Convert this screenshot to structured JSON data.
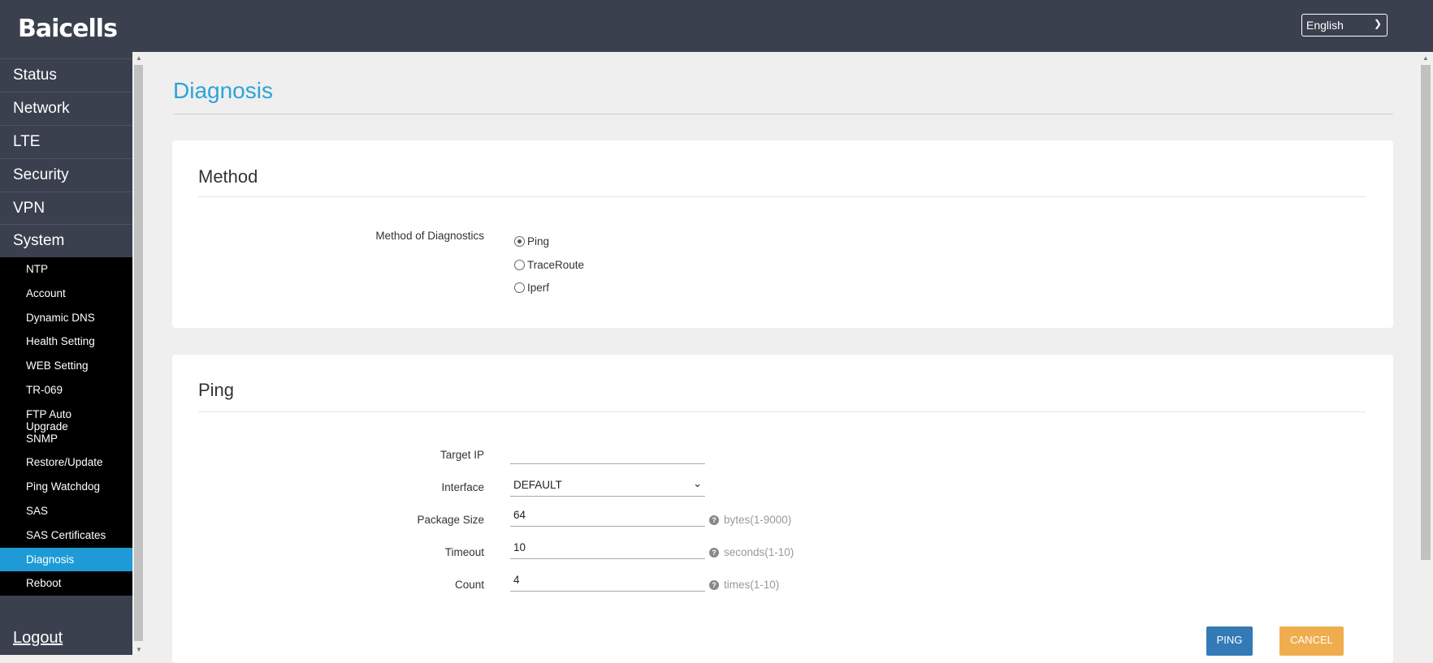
{
  "header": {
    "logo": "Baicells",
    "language": "English"
  },
  "sidebar": {
    "items": [
      "Status",
      "Network",
      "LTE",
      "Security",
      "VPN",
      "System"
    ],
    "system_items": [
      "NTP",
      "Account",
      "Dynamic DNS",
      "Health Setting",
      "WEB Setting",
      "TR-069",
      "FTP Auto Upgrade",
      "SNMP",
      "Restore/Update",
      "Ping Watchdog",
      "SAS",
      "SAS Certificates",
      "Diagnosis",
      "Reboot"
    ],
    "active": "Diagnosis",
    "logout": "Logout"
  },
  "page": {
    "title": "Diagnosis"
  },
  "method": {
    "heading": "Method",
    "label": "Method of Diagnostics",
    "options": [
      "Ping",
      "TraceRoute",
      "Iperf"
    ],
    "selected": "Ping"
  },
  "ping": {
    "heading": "Ping",
    "target_ip": {
      "label": "Target IP",
      "value": ""
    },
    "interface": {
      "label": "Interface",
      "value": "DEFAULT"
    },
    "package_size": {
      "label": "Package Size",
      "value": "64",
      "help": "bytes(1-9000)"
    },
    "timeout": {
      "label": "Timeout",
      "value": "10",
      "help": "seconds(1-10)"
    },
    "count": {
      "label": "Count",
      "value": "4",
      "help": "times(1-10)"
    },
    "ping_button": "PING",
    "cancel_button": "CANCEL"
  },
  "colors": {
    "header": "#3a404e",
    "accent": "#1e9bd7",
    "ping": "#337ab7",
    "cancel": "#f0ad4e"
  }
}
